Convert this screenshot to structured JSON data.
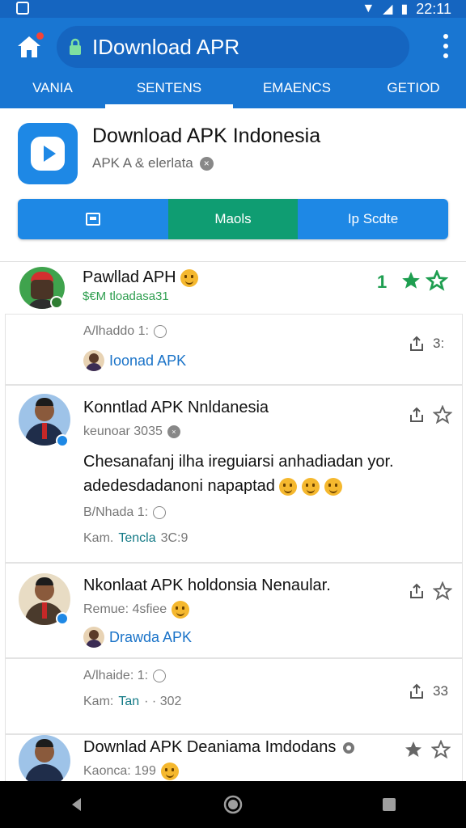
{
  "status_bar": {
    "time": "22:11"
  },
  "browser": {
    "url": "IDownload APR"
  },
  "tabs": [
    "VANIA",
    "SENTENS",
    "EMAENCS",
    "GETIOD"
  ],
  "app": {
    "title": "Download APK Indonesia",
    "subtitle": "APK A & elerlata",
    "segments": [
      "",
      "Maols",
      "Ip Scdte"
    ]
  },
  "top_post": {
    "title": "Pawllad APH",
    "sub": "$€M tloadasa31",
    "rating_number": "1"
  },
  "posts": [
    {
      "meta": "A/lhaddo 1:",
      "link": "Ioonad APK",
      "count": "3:"
    },
    {
      "title": "Konntlad APK Nnldanesia",
      "meta": "keunoar 3035",
      "body1": "Chesanafanj ilha ireguiarsi anhadiadan yor.",
      "body2": "adedesdadanoni napaptad",
      "meta2": "B/Nhada 1:",
      "meta3_prefix": "Kam.",
      "meta3_link": "Tencla",
      "meta3_suffix": "3C:9"
    },
    {
      "title": "Nkonlaat APK holdonsia Nenaular.",
      "meta": "Remue: 4sfiee",
      "link": "Drawda APK"
    },
    {
      "meta": "A/lhaide: 1:",
      "meta2_prefix": "Kam:",
      "meta2_link": "Tan",
      "meta2_suffix": "· · 302",
      "count": "33"
    },
    {
      "title": "Downlad APK Deaniama Imdodans",
      "meta": "Kaonca: 199"
    }
  ]
}
